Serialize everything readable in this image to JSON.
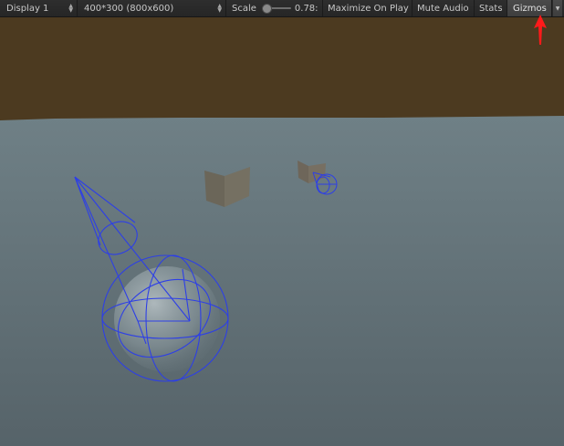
{
  "toolbar": {
    "display_label": "Display 1",
    "resolution_label": "400*300 (800x600)",
    "scale_label": "Scale",
    "scale_value": "0.78:",
    "scale_fraction": 0.0,
    "maximize_label": "Maximize On Play",
    "mute_label": "Mute Audio",
    "stats_label": "Stats",
    "gizmos_label": "Gizmos"
  },
  "colors": {
    "toolbar_bg": "#282828",
    "sky": "#4c3a20",
    "ground_far": "#6e7f86",
    "ground_near": "#56646a",
    "gizmo": "#2d3fe6",
    "annotation_arrow": "#ff1a1a"
  },
  "scene": {
    "icons": [
      "dropdown-arrows-icon",
      "slider-thumb-icon",
      "dropdown-chevron-icon",
      "red-arrow-annotation-icon"
    ]
  }
}
